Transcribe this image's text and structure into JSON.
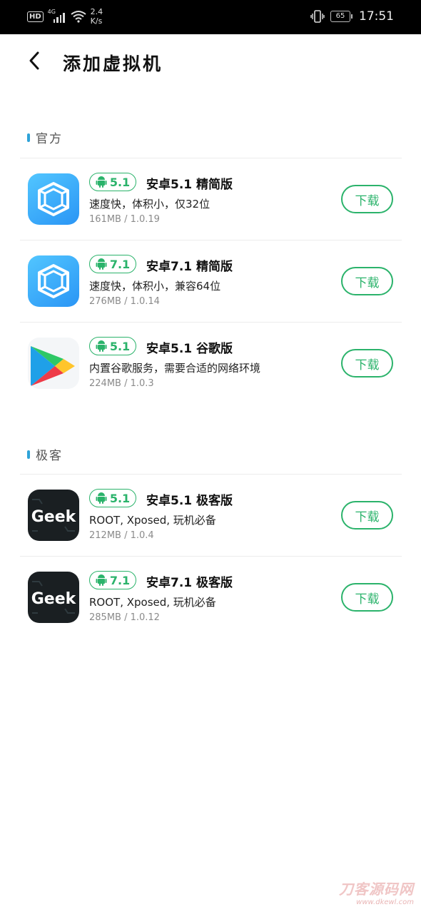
{
  "status_bar": {
    "hd": "HD",
    "network": "4G",
    "speed_top": "2.4",
    "speed_bottom": "K/s",
    "battery": "65",
    "time": "17:51"
  },
  "header": {
    "title": "添加虚拟机"
  },
  "sections": [
    {
      "title": "官方",
      "items": [
        {
          "icon": "virtual-machine-icon",
          "version": "5.1",
          "name": "安卓5.1 精简版",
          "desc": "速度快，体积小，仅32位",
          "meta": "161MB / 1.0.19",
          "button": "下载"
        },
        {
          "icon": "virtual-machine-icon",
          "version": "7.1",
          "name": "安卓7.1 精简版",
          "desc": "速度快，体积小，兼容64位",
          "meta": "276MB / 1.0.14",
          "button": "下载"
        },
        {
          "icon": "google-play-icon",
          "version": "5.1",
          "name": "安卓5.1 谷歌版",
          "desc": "内置谷歌服务，需要合适的网络环境",
          "meta": "224MB / 1.0.3",
          "button": "下载"
        }
      ]
    },
    {
      "title": "极客",
      "items": [
        {
          "icon": "geek-icon",
          "icon_text": "Geek",
          "version": "5.1",
          "name": "安卓5.1 极客版",
          "desc": "ROOT, Xposed, 玩机必备",
          "meta": "212MB / 1.0.4",
          "button": "下载"
        },
        {
          "icon": "geek-icon",
          "icon_text": "Geek",
          "version": "7.1",
          "name": "安卓7.1 极客版",
          "desc": "ROOT, Xposed, 玩机必备",
          "meta": "285MB / 1.0.12",
          "button": "下载"
        }
      ]
    }
  ],
  "watermark": {
    "line1": "刀客源码网",
    "line2": "www.dkewl.com"
  },
  "colors": {
    "accent": "#2bb36b",
    "section_dot": "#2fa3d8"
  }
}
